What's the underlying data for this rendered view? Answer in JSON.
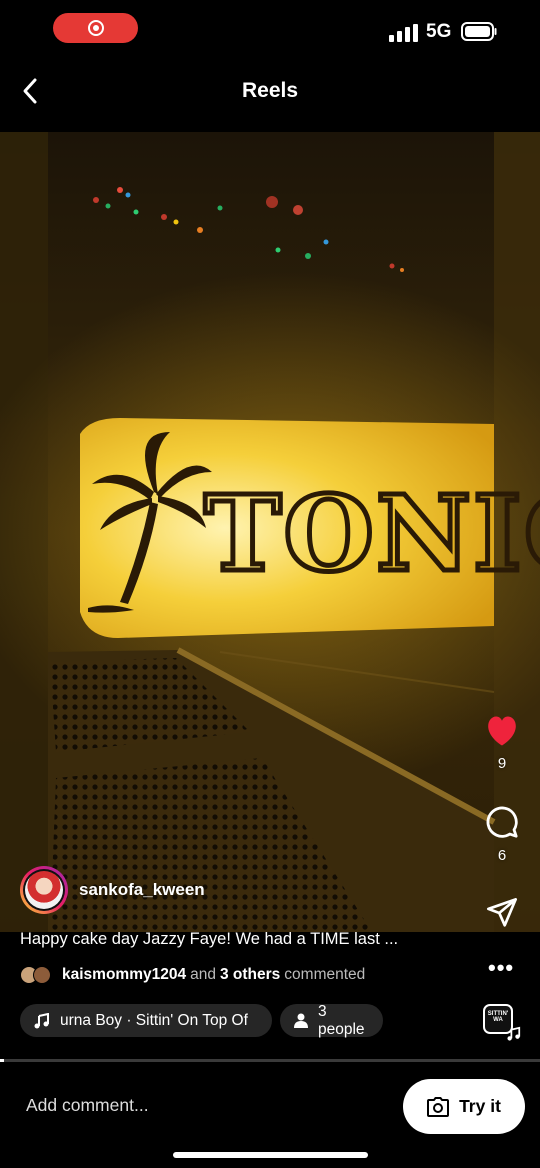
{
  "status": {
    "network": "5G",
    "recording": true
  },
  "header": {
    "title": "Reels",
    "back_icon": "chevron-left-icon"
  },
  "video": {
    "sign_text": "TONIG",
    "scene": "night street sign with palm tree"
  },
  "actions": {
    "likes": "9",
    "comments": "6",
    "like_color": "#ef233c"
  },
  "author": {
    "username": "sankofa_kween"
  },
  "caption": {
    "text": "Happy cake day Jazzy Faye! We had a TIME last ...",
    "more": "•••"
  },
  "commenters": {
    "user": "kaismommy1204",
    "and": "and",
    "others": "3 others",
    "suffix": "commented"
  },
  "music": {
    "label": "urna Boy · Sittin' On Top Of"
  },
  "people": {
    "label": "3 people"
  },
  "audio_thumb": {
    "label": "SITTIN' WA"
  },
  "footer": {
    "comment_placeholder": "Add comment...",
    "try_label": "Try it"
  }
}
